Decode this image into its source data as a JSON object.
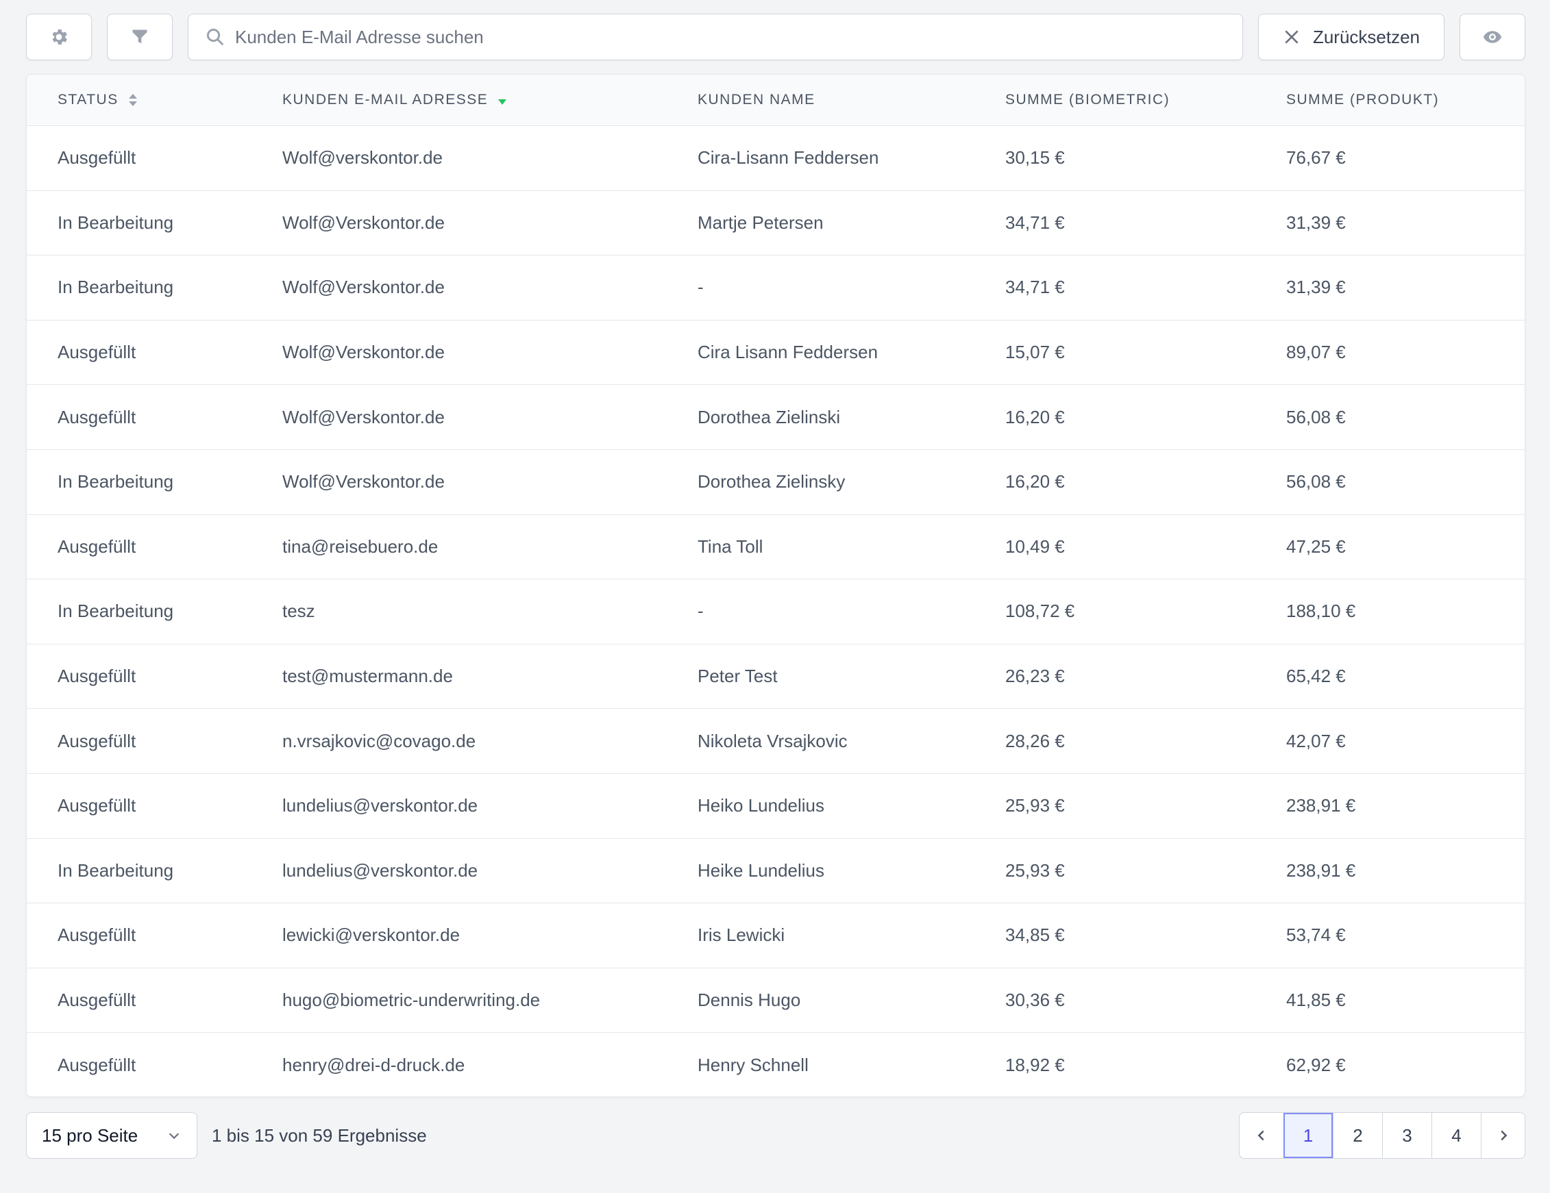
{
  "toolbar": {
    "search_placeholder": "Kunden E-Mail Adresse suchen",
    "search_value": "",
    "reset_label": "Zurücksetzen"
  },
  "table": {
    "columns": [
      "Status",
      "Kunden E-Mail Adresse",
      "Kunden Name",
      "Summe (Biometric)",
      "Summe (Produkt)"
    ],
    "rows": [
      [
        "Ausgefüllt",
        "Wolf@verskontor.de",
        "Cira-Lisann Feddersen",
        "30,15 €",
        "76,67 €"
      ],
      [
        "In Bearbeitung",
        "Wolf@Verskontor.de",
        "Martje Petersen",
        "34,71 €",
        "31,39 €"
      ],
      [
        "In Bearbeitung",
        "Wolf@Verskontor.de",
        "-",
        "34,71 €",
        "31,39 €"
      ],
      [
        "Ausgefüllt",
        "Wolf@Verskontor.de",
        "Cira Lisann Feddersen",
        "15,07 €",
        "89,07 €"
      ],
      [
        "Ausgefüllt",
        "Wolf@Verskontor.de",
        "Dorothea Zielinski",
        "16,20 €",
        "56,08 €"
      ],
      [
        "In Bearbeitung",
        "Wolf@Verskontor.de",
        "Dorothea Zielinsky",
        "16,20 €",
        "56,08 €"
      ],
      [
        "Ausgefüllt",
        "tina@reisebuero.de",
        "Tina Toll",
        "10,49 €",
        "47,25 €"
      ],
      [
        "In Bearbeitung",
        "tesz",
        "-",
        "108,72 €",
        "188,10 €"
      ],
      [
        "Ausgefüllt",
        "test@mustermann.de",
        "Peter Test",
        "26,23 €",
        "65,42 €"
      ],
      [
        "Ausgefüllt",
        "n.vrsajkovic@covago.de",
        "Nikoleta Vrsajkovic",
        "28,26 €",
        "42,07 €"
      ],
      [
        "Ausgefüllt",
        "lundelius@verskontor.de",
        "Heiko Lundelius",
        "25,93 €",
        "238,91 €"
      ],
      [
        "In Bearbeitung",
        "lundelius@verskontor.de",
        "Heike Lundelius",
        "25,93 €",
        "238,91 €"
      ],
      [
        "Ausgefüllt",
        "lewicki@verskontor.de",
        "Iris Lewicki",
        "34,85 €",
        "53,74 €"
      ],
      [
        "Ausgefüllt",
        "hugo@biometric-underwriting.de",
        "Dennis Hugo",
        "30,36 €",
        "41,85 €"
      ],
      [
        "Ausgefüllt",
        "henry@drei-d-druck.de",
        "Henry Schnell",
        "18,92 €",
        "62,92 €"
      ]
    ]
  },
  "footer": {
    "per_page": "15 pro Seite",
    "results_text": "1 bis 15 von 59 Ergebnisse",
    "pages": [
      "1",
      "2",
      "3",
      "4"
    ],
    "active_page": "1"
  },
  "colors": {
    "sort_active": "#22c55e",
    "page_active": "#4f46e5"
  }
}
